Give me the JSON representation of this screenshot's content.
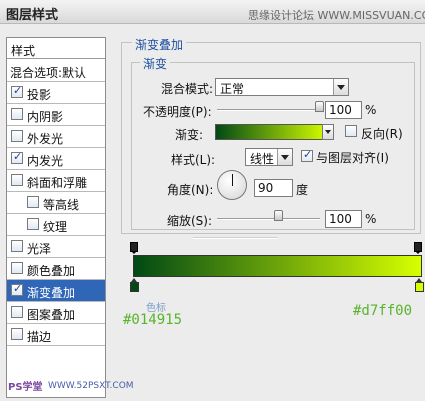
{
  "window": {
    "title": "图层样式",
    "watermark": "思缘设计论坛 WWW.MISSVUAN.COM"
  },
  "styles_panel": {
    "header": "样式",
    "items": [
      {
        "label": "混合选项:默认",
        "checkbox": false,
        "checked": false,
        "indent": false,
        "selected": false
      },
      {
        "label": "投影",
        "checkbox": true,
        "checked": true,
        "indent": false,
        "selected": false
      },
      {
        "label": "内阴影",
        "checkbox": true,
        "checked": false,
        "indent": false,
        "selected": false
      },
      {
        "label": "外发光",
        "checkbox": true,
        "checked": false,
        "indent": false,
        "selected": false
      },
      {
        "label": "内发光",
        "checkbox": true,
        "checked": true,
        "indent": false,
        "selected": false
      },
      {
        "label": "斜面和浮雕",
        "checkbox": true,
        "checked": false,
        "indent": false,
        "selected": false
      },
      {
        "label": "等高线",
        "checkbox": true,
        "checked": false,
        "indent": true,
        "selected": false
      },
      {
        "label": "纹理",
        "checkbox": true,
        "checked": false,
        "indent": true,
        "selected": false
      },
      {
        "label": "光泽",
        "checkbox": true,
        "checked": false,
        "indent": false,
        "selected": false
      },
      {
        "label": "颜色叠加",
        "checkbox": true,
        "checked": false,
        "indent": false,
        "selected": false
      },
      {
        "label": "渐变叠加",
        "checkbox": true,
        "checked": true,
        "indent": false,
        "selected": true
      },
      {
        "label": "图案叠加",
        "checkbox": true,
        "checked": false,
        "indent": false,
        "selected": false
      },
      {
        "label": "描边",
        "checkbox": true,
        "checked": false,
        "indent": false,
        "selected": false
      }
    ]
  },
  "gradient_overlay": {
    "section_title": "渐变叠加",
    "group_title": "渐变",
    "blend_mode": {
      "label": "混合模式:",
      "value": "正常"
    },
    "opacity": {
      "label": "不透明度(P):",
      "value": "100",
      "unit": "%",
      "level": 1.0
    },
    "gradient": {
      "label": "渐变:",
      "start_color": "#014915",
      "end_color": "#d7ff00"
    },
    "reverse": {
      "label": "反向(R)",
      "checked": false
    },
    "style": {
      "label": "样式(L):",
      "value": "线性"
    },
    "align_with_layer": {
      "label": "与图层对齐(I)",
      "checked": true
    },
    "angle": {
      "label": "角度(N):",
      "value": "90",
      "unit": "度"
    },
    "scale": {
      "label": "缩放(S):",
      "value": "100",
      "unit": "%",
      "level": 0.6
    }
  },
  "gradient_editor": {
    "left_color": "#014915",
    "right_color": "#d7ff00",
    "left_hex": "#014915",
    "right_hex": "#d7ff00",
    "stops_label": "色标"
  },
  "footer": {
    "badge": "PS学堂",
    "url": "WWW.52PSXT.COM"
  }
}
